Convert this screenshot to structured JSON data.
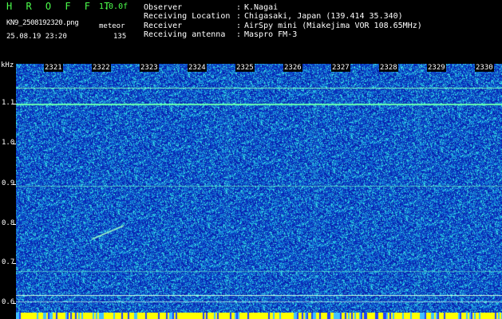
{
  "app": {
    "title": "H R O F F T",
    "version": "1.0.0f"
  },
  "file": {
    "name": "KN9_2508192320.png",
    "mode": "meteor",
    "datetime": "25.08.19 23:20",
    "count": "135"
  },
  "info": [
    {
      "label": "Observer",
      "value": "K.Nagai"
    },
    {
      "label": "Receiving Location",
      "value": "Chigasaki, Japan (139.414 35.340)"
    },
    {
      "label": "Receiver",
      "value": "AirSpy mini (Miakejima VOR 108.65MHz)"
    },
    {
      "label": "Receiving antenna",
      "value": "Maspro FM-3"
    }
  ],
  "axis": {
    "unit": "kHz",
    "y_ticks": [
      "1.1",
      "1.0",
      "0.9",
      "0.8",
      "0.7",
      "0.6"
    ],
    "minutes": [
      "2321",
      "2322",
      "2323",
      "2324",
      "2325",
      "2326",
      "2327",
      "2328",
      "2329",
      "2330"
    ]
  },
  "colors": {
    "accent": "#4cff4c",
    "background": "#0a2fb8",
    "noise": "#3ccfe8",
    "tone": "#7affc0",
    "bar": "#ffff00"
  }
}
